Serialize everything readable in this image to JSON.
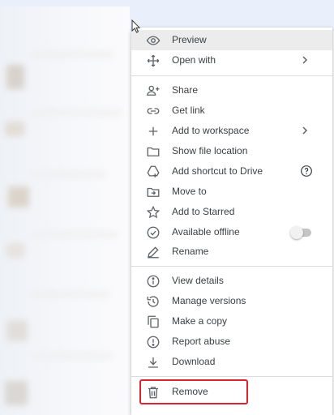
{
  "menu": {
    "items": [
      {
        "label": "Preview"
      },
      {
        "label": "Open with"
      },
      {
        "label": "Share"
      },
      {
        "label": "Get link"
      },
      {
        "label": "Add to workspace"
      },
      {
        "label": "Show file location"
      },
      {
        "label": "Add shortcut to Drive"
      },
      {
        "label": "Move to"
      },
      {
        "label": "Add to Starred"
      },
      {
        "label": "Available offline"
      },
      {
        "label": "Rename"
      },
      {
        "label": "View details"
      },
      {
        "label": "Manage versions"
      },
      {
        "label": "Make a copy"
      },
      {
        "label": "Report abuse"
      },
      {
        "label": "Download"
      },
      {
        "label": "Remove"
      }
    ],
    "icons": [
      "eye-icon",
      "move-arrows-icon",
      "add-person-icon",
      "link-icon",
      "plus-icon",
      "folder-icon",
      "add-to-drive-icon",
      "move-folder-icon",
      "star-icon",
      "offline-check-icon",
      "pencil-icon",
      "info-icon",
      "history-icon",
      "copy-icon",
      "alert-icon",
      "download-icon",
      "trash-icon"
    ],
    "available_offline": false,
    "highlight_color": "#d9232e"
  }
}
